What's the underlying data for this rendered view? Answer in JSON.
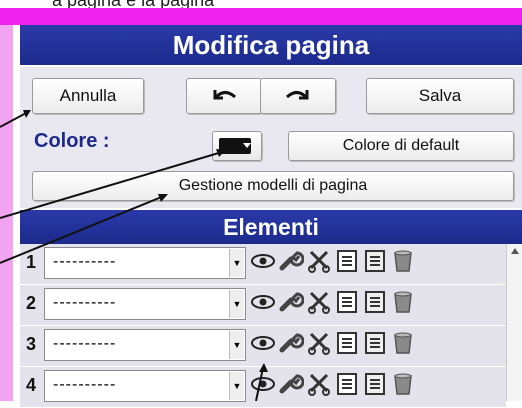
{
  "caption": "a pagina e la pagina",
  "panel": {
    "title": "Modifica  pagina",
    "buttons": {
      "cancel": "Annulla",
      "save": "Salva",
      "undo_icon": "undo-icon",
      "redo_icon": "redo-icon"
    },
    "color": {
      "label": "Colore :",
      "swatch": "#111111",
      "default_label": "Colore di default"
    },
    "templates_label": "Gestione modelli di pagina"
  },
  "elements": {
    "title": "Elementi",
    "rows": [
      {
        "num": "1",
        "value": "----------"
      },
      {
        "num": "2",
        "value": "----------"
      },
      {
        "num": "3",
        "value": "----------"
      },
      {
        "num": "4",
        "value": "----------"
      }
    ],
    "row_icons": [
      "eye-icon",
      "wrench-icon",
      "scissors-icon",
      "copy-icon",
      "text-icon",
      "trash-icon"
    ]
  },
  "colors": {
    "header": "#1c2a8c",
    "accent": "#ee22ee"
  }
}
